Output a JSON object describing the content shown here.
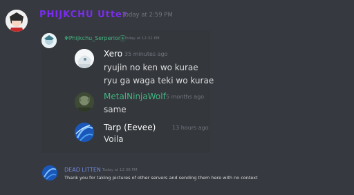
{
  "outer": {
    "author": "PHIJKCHU Utter",
    "author_color": "#7b2cf0",
    "timestamp": "Today at 2:59 PM"
  },
  "quoted": {
    "author": "✻Phijkchu_Serperior🀀",
    "author_color": "#43b581",
    "timestamp": "Today at 12:32 PM"
  },
  "messages": [
    {
      "author": "Xero",
      "author_color": "#ffffff",
      "timestamp": "35 minutes ago",
      "lines": [
        "ryujin no ken wo kurae",
        "ryu ga waga teki wo kurae"
      ]
    },
    {
      "author": "MetalNinjaWolf",
      "author_color": "#43b581",
      "timestamp": "5 months ago",
      "lines": [
        "same"
      ]
    },
    {
      "author": "Tarp (Eevee)",
      "author_color": "#ffffff",
      "timestamp": "13 hours ago",
      "lines": [
        "Voila"
      ]
    }
  ],
  "footer_message": {
    "author": "DEAD LITTEN",
    "author_color": "#7289da",
    "timestamp": "Today at 12:38 PM",
    "text": "Thank you for taking pictures of other servers and sending them here with no context"
  },
  "icons": {
    "outer_avatar": "anime-avatar-icon",
    "quoted_avatar": "anime-avatar-icon",
    "xero_avatar": "white-anime-avatar-icon",
    "metal_avatar": "wolf-avatar-icon",
    "tarp_avatar": "blue-swirl-avatar-icon",
    "dead_avatar": "blue-swirl-avatar-icon"
  }
}
